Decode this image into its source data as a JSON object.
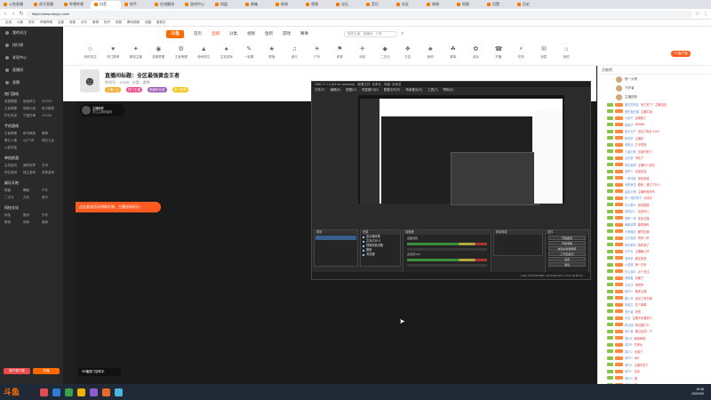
{
  "browser": {
    "tabs": [
      "斗鱼直播",
      "虎牙直播",
      "哔哩哔哩",
      "抖音",
      "快手",
      "在线翻译",
      "游戏中心",
      "网盘",
      "邮箱",
      "新闻",
      "视频",
      "论坛",
      "音乐",
      "社区",
      "商城",
      "地图",
      "设置",
      "历史"
    ],
    "url": "https://www.douyu.com/",
    "bookmarks": [
      "应用",
      "斗鱼",
      "虎牙",
      "哔哩哔哩",
      "百度",
      "淘宝",
      "京东",
      "微博",
      "知乎",
      "网易",
      "腾讯视频",
      "优酷",
      "爱奇艺"
    ]
  },
  "sidebar": {
    "top_items": [
      "我的关注",
      "排行榜",
      "发现中心",
      "直播间",
      "直播"
    ],
    "section_hot": "热门游戏",
    "hot_games": [
      "英雄联盟",
      "绝地求生",
      "DOTA2",
      "王者荣耀",
      "穿越火线",
      "和平精英",
      "炉石传说",
      "守望先锋",
      "CS:GO"
    ],
    "section_mobile": "手机游戏",
    "mobile_games": [
      "王者荣耀",
      "和平精英",
      "原神",
      "第五人格",
      "QQ飞车",
      "明日之后",
      "火影忍者"
    ],
    "section_single": "单机热游",
    "single_games": [
      "主机游戏",
      "我的世界",
      "方舟",
      "怀旧游戏",
      "独立游戏",
      "恐怖游戏"
    ],
    "section_variety": "娱乐天地",
    "variety": [
      "颜值",
      "舞蹈",
      "户外",
      "二次元",
      "交友",
      "音乐"
    ],
    "section_other": "科技文化",
    "other": [
      "科技",
      "数码",
      "汽车",
      "教育",
      "体育",
      "美食"
    ],
    "button_left": "客户端下载",
    "button_right": "开播"
  },
  "header": {
    "logo": "斗鱼",
    "nav": [
      "首页",
      "直播",
      "分类",
      "视频",
      "鱼吧",
      "游戏",
      "赛事"
    ],
    "search_placeholder": "搜索主播、直播间、分类"
  },
  "categories": [
    {
      "icon": "☺",
      "label": "我的关注"
    },
    {
      "icon": "♥",
      "label": "热门推荐"
    },
    {
      "icon": "✦",
      "label": "精选主播"
    },
    {
      "icon": "◉",
      "label": "英雄联盟"
    },
    {
      "icon": "⚙",
      "label": "王者荣耀"
    },
    {
      "icon": "▲",
      "label": "绝地求生"
    },
    {
      "icon": "♠",
      "label": "主机游戏"
    },
    {
      "icon": "✎",
      "label": "一起看"
    },
    {
      "icon": "★",
      "label": "颜值"
    },
    {
      "icon": "♫",
      "label": "音乐"
    },
    {
      "icon": "☀",
      "label": "户外"
    },
    {
      "icon": "⚑",
      "label": "体育"
    },
    {
      "icon": "✈",
      "label": "科技"
    },
    {
      "icon": "◆",
      "label": "二次元"
    },
    {
      "icon": "❖",
      "label": "交友"
    },
    {
      "icon": "♣",
      "label": "鱼吧"
    },
    {
      "icon": "☘",
      "label": "赛事"
    },
    {
      "icon": "✿",
      "label": "活动"
    },
    {
      "icon": "☎",
      "label": "开播"
    },
    {
      "icon": "⚡",
      "label": "任务"
    },
    {
      "icon": "✉",
      "label": "消息"
    },
    {
      "icon": "⌂",
      "label": "我的"
    }
  ],
  "room": {
    "title": "直播间标题：全区最强黄金王者",
    "meta": "房间号：12345 · 分类：游戏",
    "badges": [
      "主播认证",
      "热门主播",
      "超级粉丝团",
      "新人推荐"
    ]
  },
  "video": {
    "follow_name": "主播昵称",
    "follow_sub": "关注主播领福利",
    "danmu_banner": "点击参加活动领取礼物，主播送你好礼~",
    "bottom_toast": "3D播放门店助手"
  },
  "obs": {
    "title": "OBS 27.1.3 (64 bit, windows) - 配置文件: 未命名 - 场景: 未命名",
    "menu": [
      "文件(F)",
      "编辑(E)",
      "视图(V)",
      "停靠窗口(D)",
      "配置文件(P)",
      "场景集合(S)",
      "工具(T)",
      "帮助(H)"
    ],
    "scenes_header": "场景",
    "sources_header": "来源",
    "sources": [
      "显示器采集",
      "文本(GDI+)",
      "视频采集设备",
      "图像",
      "浏览器"
    ],
    "mixer_header": "混音器",
    "mixer_channels": [
      "桌面音频",
      "麦克风/Aux"
    ],
    "transitions_header": "转场特效",
    "controls_header": "控件",
    "controls": [
      "开始推流",
      "开始录制",
      "启动虚拟摄像机",
      "工作室模式",
      "设置",
      "退出"
    ],
    "status": "LIVE: 00:00:00   REC: 00:00:00   CPU: 1.2%, 30.00 fps"
  },
  "chat": {
    "header": "贡献榜",
    "ranks": [
      "榜一大哥",
      "守护者",
      "主播铁粉"
    ],
    "corner_button": "PC客户端",
    "messages": [
      {
        "user": "路过的网友",
        "text": "来了来了！主播加油"
      },
      {
        "user": "爱吃鱼的猫",
        "text": "主播牛逼"
      },
      {
        "user": "小鱼干",
        "text": "这局稳了"
      },
      {
        "user": "夜猫子",
        "text": "666666"
      },
      {
        "user": "鱼丸大户",
        "text": "送出了鱼丸 x100"
      },
      {
        "user": "新来的",
        "text": "主播好"
      },
      {
        "user": "老粉丝",
        "text": "打卡签到"
      },
      {
        "user": "王者归来",
        "text": "这操作绝了"
      },
      {
        "user": "云玩家",
        "text": "学到了"
      },
      {
        "user": "快乐星球",
        "text": "主播什么段位"
      },
      {
        "user": "追梦人",
        "text": "加油加油"
      },
      {
        "user": "一条咸鱼",
        "text": "哈哈哈哈"
      },
      {
        "user": "深夜食堂",
        "text": "刚来，错过了什么"
      },
      {
        "user": "星辰大海",
        "text": "主播声音好听"
      },
      {
        "user": "风一样的男子",
        "text": "冲冲冲"
      },
      {
        "user": "吃瓜群众",
        "text": "前排围观"
      },
      {
        "user": "游戏达人",
        "text": "这波可以"
      },
      {
        "user": "铁粉一号",
        "text": "支持主播"
      },
      {
        "user": "萌新求带",
        "text": "能带我吗"
      },
      {
        "user": "大神路过",
        "text": "细节拉满"
      },
      {
        "user": "月光宝盒",
        "text": "再来一把"
      },
      {
        "user": "快乐肥宅",
        "text": "笑死我了"
      },
      {
        "user": "白开水",
        "text": "主播晚上好"
      },
      {
        "user": "老司机",
        "text": "稳住别浪"
      },
      {
        "user": "小透明",
        "text": "第一次来"
      },
      {
        "user": "热心观众",
        "text": "点个关注"
      },
      {
        "user": "旁观者",
        "text": "厉害了"
      },
      {
        "user": "无名氏",
        "text": "赞赞赞"
      },
      {
        "user": "夜归人",
        "text": "晚安主播"
      },
      {
        "user": "路人甲",
        "text": "送出了荧光棒"
      },
      {
        "user": "鱼塘主",
        "text": "发个弹幕"
      },
      {
        "user": "追光者",
        "text": "好看"
      },
      {
        "user": "水友",
        "text": "主播今天播多久"
      },
      {
        "user": "粉丝团",
        "text": "粉丝团打卡"
      },
      {
        "user": "旅行者",
        "text": "路过支持一下"
      },
      {
        "user": "观众A",
        "text": "继续继续"
      },
      {
        "user": "观众B",
        "text": "好家伙"
      },
      {
        "user": "观众C",
        "text": "太强了"
      },
      {
        "user": "观众D",
        "text": "666"
      },
      {
        "user": "观众E",
        "text": "主播辛苦了"
      },
      {
        "user": "观众F",
        "text": "加油"
      },
      {
        "user": "观众G",
        "text": "稳"
      },
      {
        "user": "观众H",
        "text": "牛"
      }
    ]
  },
  "taskbar": {
    "logo": "斗鱼",
    "time": "19:46",
    "date": "2022/4/9",
    "icon_colors": [
      "#e24c4c",
      "#2d7dd2",
      "#3aa14f",
      "#f2b100",
      "#8e5ccf",
      "#e86a2b",
      "#4cb5e0"
    ]
  }
}
